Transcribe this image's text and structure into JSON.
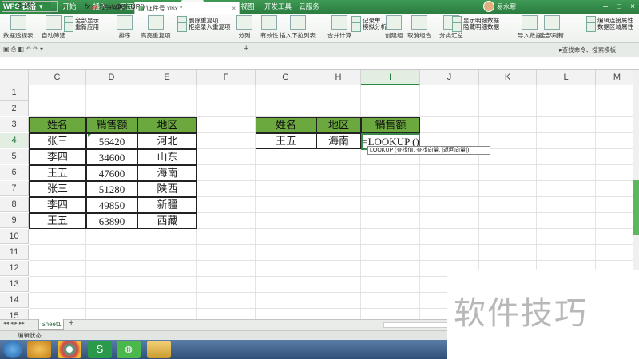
{
  "app": {
    "title": "WPS 表格",
    "dropdown": "▾"
  },
  "menu": [
    "开始",
    "插入",
    "页面布局",
    "公式",
    "数据",
    "审阅",
    "视图",
    "开发工具",
    "云服务"
  ],
  "active_menu": "数据",
  "user": {
    "name": "易水寒"
  },
  "ribbon": {
    "items": [
      "数据透视表",
      "自动筛选",
      "全部显示",
      "重新应用",
      "排序",
      "高亮重复项",
      "删除重复项",
      "拒绝录入重复项",
      "分列",
      "有效性",
      "插入下拉列表",
      "合并计算",
      "记录单",
      "模拟分析",
      "创建组",
      "取消组合",
      "分类汇总",
      "显示明细数据",
      "隐藏明细数据",
      "导入数据",
      "全部刷新",
      "编辑连接属性",
      "数据区域属性"
    ]
  },
  "doc_tabs": [
    {
      "label": "我的WPS"
    },
    {
      "label": "证件号.xlsx *"
    }
  ],
  "formula_bar": {
    "name_box": "CHAR",
    "cancel": "×",
    "enter": "✓",
    "fx": "fx",
    "content": "=LOOKUP()"
  },
  "tip_hint": "▸查找命令、搜索模板",
  "columns": [
    "C",
    "D",
    "E",
    "F",
    "G",
    "H",
    "I",
    "J",
    "K",
    "L",
    "M"
  ],
  "rows": [
    "1",
    "2",
    "3",
    "4",
    "5",
    "6",
    "7",
    "8",
    "9",
    "10",
    "11",
    "12",
    "13",
    "14",
    "15"
  ],
  "table1": {
    "headers": [
      "姓名",
      "销售额",
      "地区"
    ],
    "rows": [
      [
        "张三",
        "56420",
        "河北"
      ],
      [
        "李四",
        "34600",
        "山东"
      ],
      [
        "王五",
        "47600",
        "海南"
      ],
      [
        "张三",
        "51280",
        "陕西"
      ],
      [
        "李四",
        "49850",
        "新疆"
      ],
      [
        "王五",
        "63890",
        "西藏"
      ]
    ]
  },
  "table2": {
    "headers": [
      "姓名",
      "地区",
      "销售额"
    ],
    "row": [
      "王五",
      "海南",
      "=LOOKUP ()"
    ]
  },
  "tooltip": "LOOKUP (查找值, 查找向量, [返回向量])",
  "sheet_tab": "Sheet1",
  "status": "编辑状态",
  "watermark": "软件技巧",
  "colors": {
    "accent": "#2b7d40",
    "header_fill": "#6ba93f"
  }
}
